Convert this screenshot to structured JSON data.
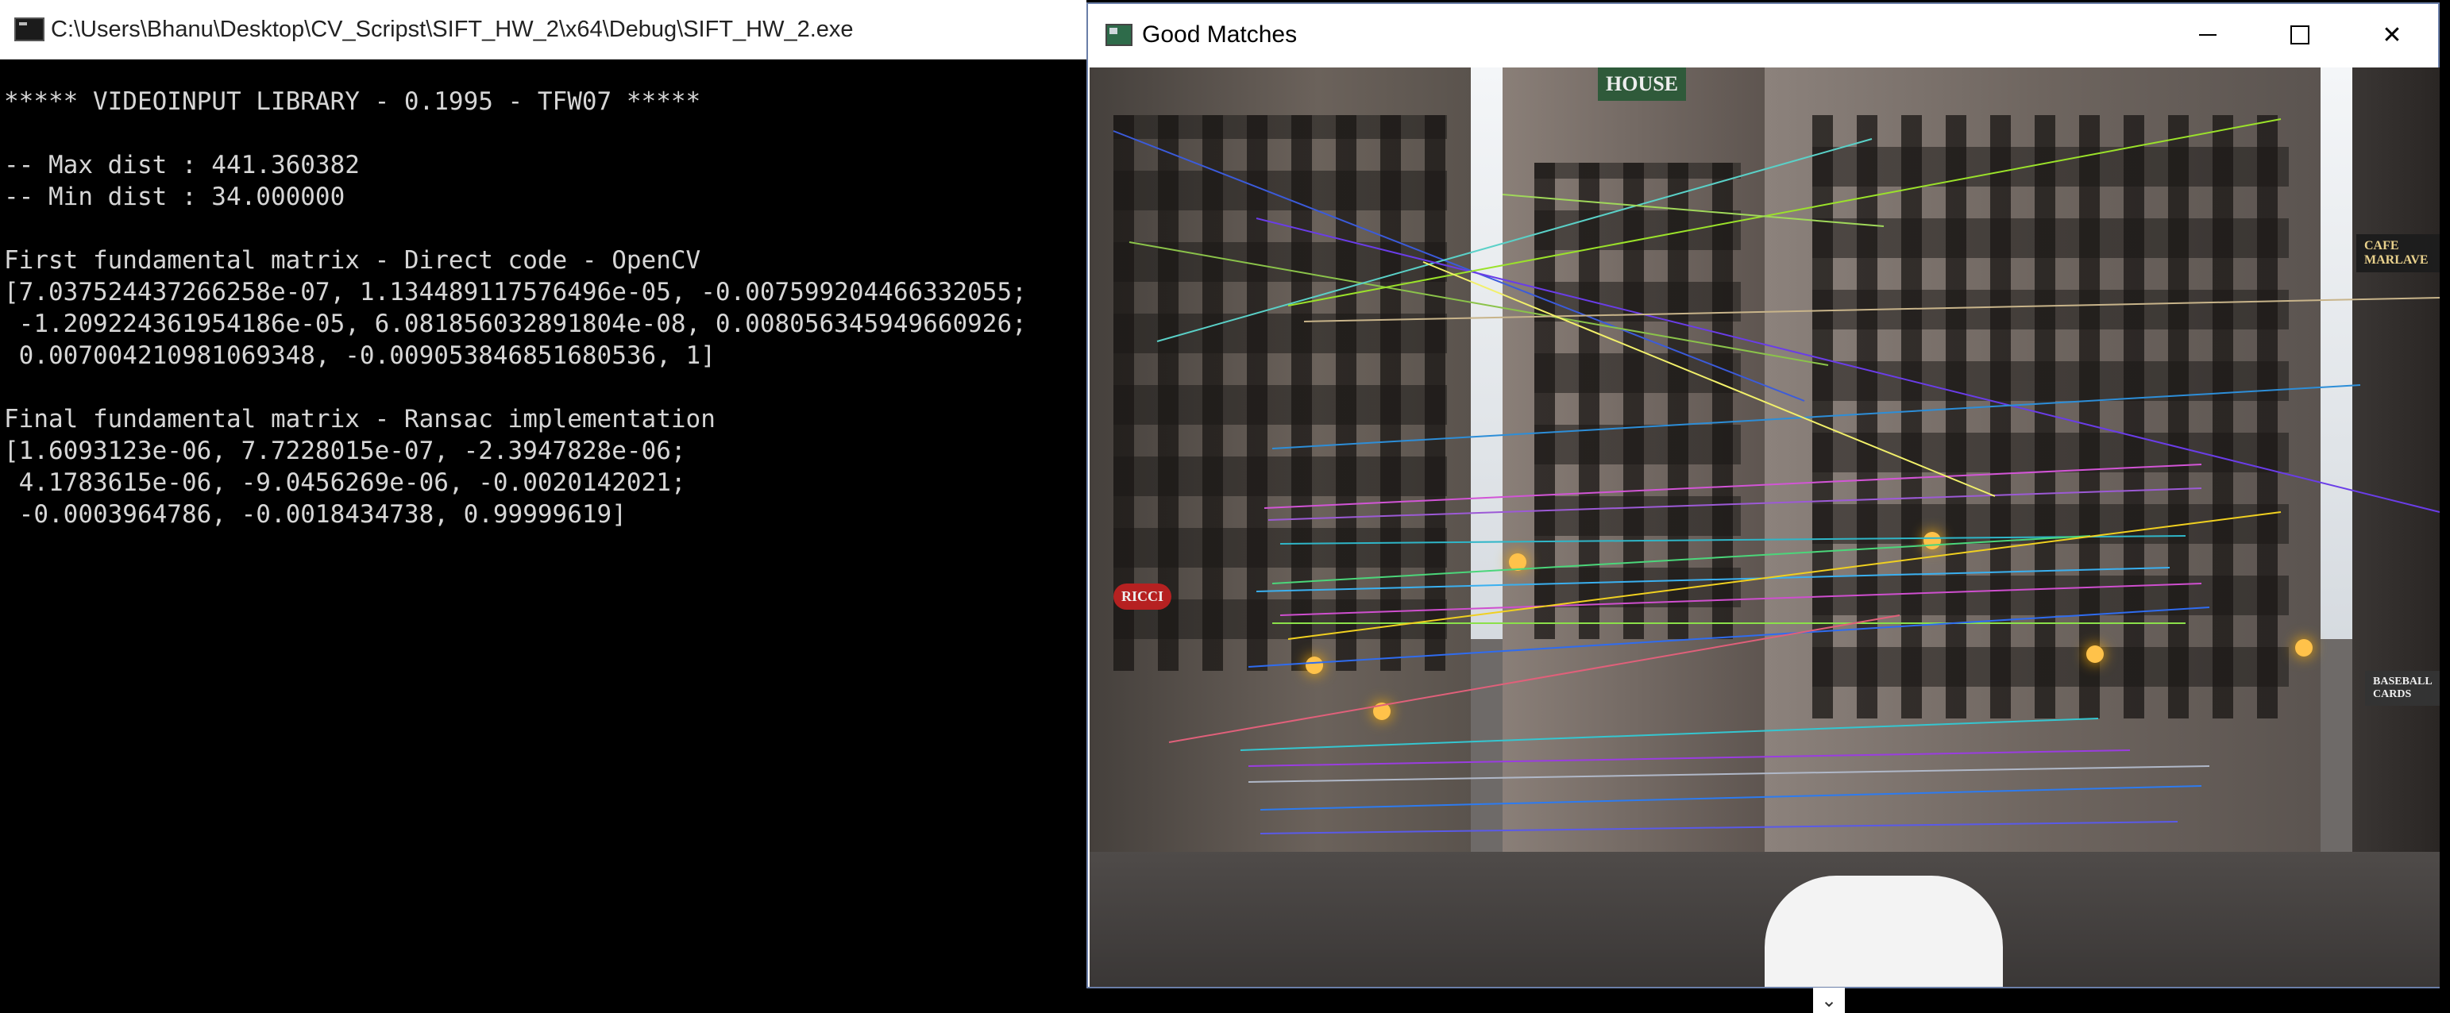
{
  "console": {
    "title": "C:\\Users\\Bhanu\\Desktop\\CV_Scripst\\SIFT_HW_2\\x64\\Debug\\SIFT_HW_2.exe",
    "lines": [
      "***** VIDEOINPUT LIBRARY - 0.1995 - TFW07 *****",
      "",
      "-- Max dist : 441.360382",
      "-- Min dist : 34.000000",
      "",
      "First fundamental matrix - Direct code - OpenCV",
      "[7.037524437266258e-07, 1.134489117576496e-05, -0.007599204466332055;",
      " -1.209224361954186e-05, 6.081856032891804e-08, 0.008056345949660926;",
      " 0.007004210981069348, -0.009053846851680536, 1]",
      "",
      "Final fundamental matrix - Ransac implementation",
      "[1.6093123e-06, 7.7228015e-07, -2.3947828e-06;",
      " 4.1783615e-06, -9.0456269e-06, -0.0020142021;",
      " -0.0003964786, -0.0018434738, 0.99999619]"
    ]
  },
  "window": {
    "title": "Good Matches",
    "minimize_icon": "minimize-icon",
    "maximize_icon": "maximize-icon",
    "close_label": "✕",
    "close_icon": "close-icon"
  },
  "image": {
    "sign_left": "HOUSE",
    "sign_cafe": "CAFE MARLAVE",
    "sign_ricci": "RICCI",
    "sign_baseball": "BASEBALL CARDS"
  },
  "scroll": {
    "chevron_label": "⌄"
  }
}
